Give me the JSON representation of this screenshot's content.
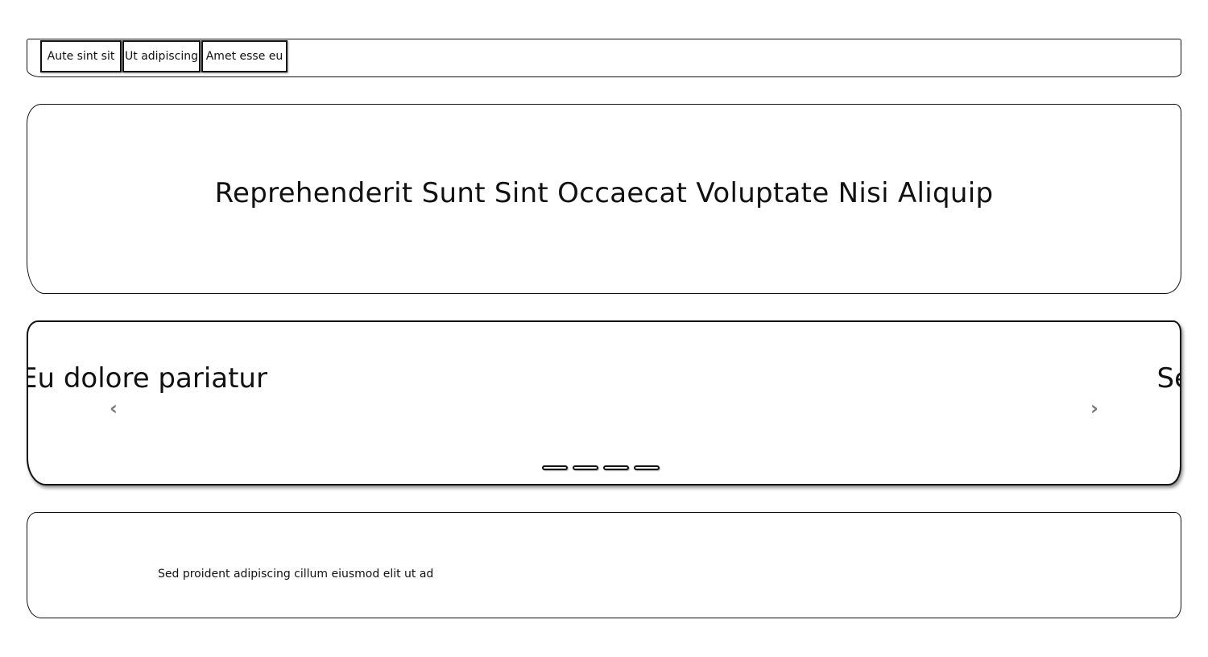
{
  "nav": {
    "tabs": [
      {
        "label": "Aute sint sit"
      },
      {
        "label": "Ut adipiscing"
      },
      {
        "label": "Amet esse eu"
      }
    ]
  },
  "hero": {
    "title": "Reprehenderit Sunt Sint Occaecat Voluptate Nisi Aliquip"
  },
  "carousel": {
    "left_slide_text": "Eu dolore pariatur",
    "right_slide_text": "Se",
    "prev_icon": "chevron-left-icon",
    "next_icon": "chevron-right-icon",
    "prev_glyph": "‹",
    "next_glyph": "›",
    "indicator_count": 4
  },
  "content": {
    "text": "Sed proident adipiscing cillum eiusmod elit ut ad"
  }
}
